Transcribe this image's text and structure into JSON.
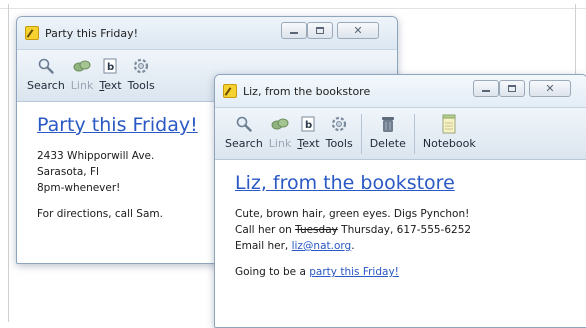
{
  "windows": [
    {
      "title": "Party this Friday!",
      "toolbar": {
        "search": "Search",
        "link": "Link",
        "text": "Text",
        "tools": "Tools"
      },
      "note_title": "Party this Friday!",
      "lines": [
        "2433 Whipporwill Ave.",
        "Sarasota, Fl",
        "8pm-whenever!",
        "For directions, call Sam."
      ]
    },
    {
      "title": "Liz, from the bookstore",
      "toolbar": {
        "search": "Search",
        "link": "Link",
        "text": "Text",
        "tools": "Tools",
        "delete": "Delete",
        "notebook": "Notebook"
      },
      "note_title": "Liz, from the bookstore",
      "line1": "Cute, brown hair, green eyes. Digs Pynchon!",
      "line2_prefix": "Call her on ",
      "line2_struck": "Tuesday",
      "line2_suffix": " Thursday, 617-555-6252",
      "line3_prefix": "Email her, ",
      "line3_link": "liz@nat.org",
      "line3_suffix": ".",
      "line4_prefix": "Going to be a ",
      "line4_link": "party this Friday!"
    }
  ],
  "colors": {
    "link": "#2a58c4",
    "title_bar": "#dce7f2",
    "toolbar": "#dbe5ef",
    "note_icon": "#f5d230"
  },
  "icons": {
    "app": "sticky-note-icon",
    "search": "magnifier-icon",
    "link": "chain-link-icon",
    "text": "text-format-icon",
    "tools": "gear-icon",
    "delete": "trash-can-icon",
    "notebook": "notebook-icon"
  }
}
